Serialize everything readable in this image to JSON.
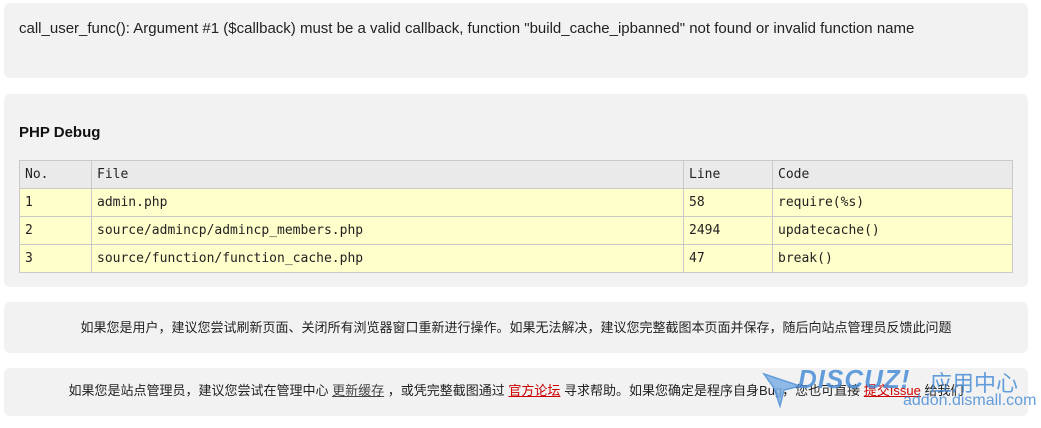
{
  "error": {
    "message": "call_user_func(): Argument #1 ($callback) must be a valid callback, function \"build_cache_ipbanned\" not found or invalid function name"
  },
  "debug": {
    "title": "PHP Debug",
    "columns": [
      "No.",
      "File",
      "Line",
      "Code"
    ],
    "rows": [
      {
        "no": "1",
        "file": "admin.php",
        "line": "58",
        "code": "require(%s)"
      },
      {
        "no": "2",
        "file": "source/admincp/admincp_members.php",
        "line": "2494",
        "code": "updatecache()"
      },
      {
        "no": "3",
        "file": "source/function/function_cache.php",
        "line": "47",
        "code": "break()"
      }
    ]
  },
  "user_notice": {
    "text": "如果您是用户，建议您尝试刷新页面、关闭所有浏览器窗口重新进行操作。如果无法解决，建议您完整截图本页面并保存，随后向站点管理员反馈此问题"
  },
  "admin_notice": {
    "prefix": "如果您是站点管理员，建议您尝试在管理中心",
    "link_cache": "更新缓存",
    "middle": "，或凭完整截图通过",
    "link_forum": "官方论坛",
    "after_forum": "寻求帮助。如果您确定是程序自身Bug，您也可直接",
    "link_issue": "提交Issue",
    "suffix": "给我们"
  },
  "watermark": {
    "logo": "DISCUZ!",
    "cn": "应用中心",
    "url": "addon.dismall.com"
  },
  "colors": {
    "panel": "#f2f2f2",
    "row_highlight": "#ffffcc",
    "header_row": "#eaeaea",
    "link_red": "#cc0000",
    "watermark_blue": "#4a8ed8"
  }
}
